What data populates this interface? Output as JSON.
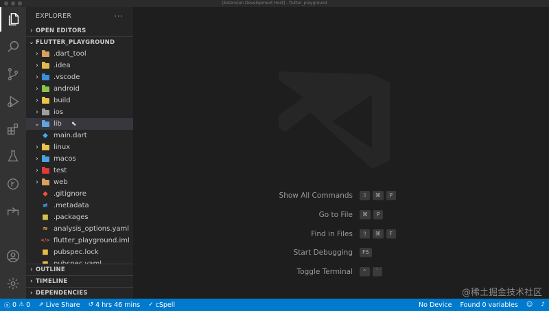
{
  "window": {
    "title": "[Extension Development Host] - flutter_playground"
  },
  "activity_bar": {
    "items": [
      "explorer-icon",
      "search-icon",
      "source-control-icon",
      "run-debug-icon",
      "extensions-icon",
      "testing-icon",
      "git-graph-icon",
      "live-share-icon",
      "account-icon",
      "settings-gear-icon"
    ]
  },
  "sidebar": {
    "title": "EXPLORER",
    "more": "···",
    "open_editors": "OPEN EDITORS",
    "project": "FLUTTER_PLAYGROUND",
    "tree": [
      {
        "name": ".dart_tool",
        "kind": "folder",
        "color": "#d9a05b"
      },
      {
        "name": ".idea",
        "kind": "folder",
        "color": "#e0b84f"
      },
      {
        "name": ".vscode",
        "kind": "folder",
        "color": "#3b8fd6"
      },
      {
        "name": "android",
        "kind": "folder",
        "color": "#8bc34a"
      },
      {
        "name": "build",
        "kind": "folder",
        "color": "#e8c44a"
      },
      {
        "name": "ios",
        "kind": "folder",
        "color": "#9e9e9e"
      },
      {
        "name": "lib",
        "kind": "folder-open",
        "color": "#5fa3e0"
      },
      {
        "name": "main.dart",
        "kind": "file",
        "color": "#3fa9f5",
        "glyph": "◆"
      },
      {
        "name": "linux",
        "kind": "folder",
        "color": "#e8c44a"
      },
      {
        "name": "macos",
        "kind": "folder",
        "color": "#4aa3df"
      },
      {
        "name": "test",
        "kind": "folder",
        "color": "#e53935"
      },
      {
        "name": "web",
        "kind": "folder",
        "color": "#d9a05b"
      },
      {
        "name": ".gitignore",
        "kind": "file",
        "color": "#f05133",
        "glyph": "◆"
      },
      {
        "name": ".metadata",
        "kind": "file",
        "color": "#42a5f5",
        "glyph": "≠"
      },
      {
        "name": ".packages",
        "kind": "file",
        "color": "#d4c24a",
        "glyph": "■"
      },
      {
        "name": "analysis_options.yaml",
        "kind": "file",
        "color": "#e8b84a",
        "glyph": "≈"
      },
      {
        "name": "flutter_playground.iml",
        "kind": "file",
        "color": "#e06c3a",
        "glyph": "</>"
      },
      {
        "name": "pubspec.lock",
        "kind": "file",
        "color": "#e8b84a",
        "glyph": "■"
      },
      {
        "name": "pubspec.yaml",
        "kind": "file",
        "color": "#e8b84a",
        "glyph": "■"
      }
    ],
    "bottom_sections": [
      "OUTLINE",
      "TIMELINE",
      "DEPENDENCIES"
    ]
  },
  "editor": {
    "shortcuts": [
      {
        "label": "Show All Commands",
        "keys": [
          "⇧",
          "⌘",
          "P"
        ]
      },
      {
        "label": "Go to File",
        "keys": [
          "⌘",
          "P"
        ]
      },
      {
        "label": "Find in Files",
        "keys": [
          "⇧",
          "⌘",
          "F"
        ]
      },
      {
        "label": "Start Debugging",
        "keys": [
          "F5"
        ]
      },
      {
        "label": "Toggle Terminal",
        "keys": [
          "^",
          "`"
        ]
      }
    ]
  },
  "watermark": "@稀土掘金技术社区",
  "statusbar": {
    "errors": "0",
    "warnings": "0",
    "live_share": "Live Share",
    "time": "4 hrs 46 mins",
    "cspell": "cSpell",
    "device": "No Device",
    "variables": "Found 0 variables"
  },
  "colors": {
    "accent": "#007acc",
    "activity_bar": "#333333",
    "sidebar": "#252526",
    "editor": "#1e1e1e"
  }
}
